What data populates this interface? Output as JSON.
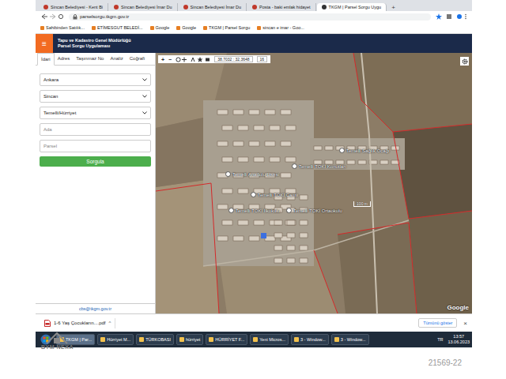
{
  "browser": {
    "tabs": [
      {
        "label": "Sincan Belediyesi - Kent Bi",
        "selected": false
      },
      {
        "label": "Sincan Belediyesi İmar Du",
        "selected": false
      },
      {
        "label": "Sincan Belediyesi İmar Du",
        "selected": false
      },
      {
        "label": "Posta - baki emlak hidayet",
        "selected": false
      },
      {
        "label": "TKGM | Parsel Sorgu Uygu",
        "selected": true
      }
    ],
    "new_tab": "+",
    "address": "parselsorgu.tkgm.gov.tr",
    "bookmarks": [
      "Sahibinden Satılık...",
      "ETİMESGUT BELEDİ...",
      "Google",
      "Google",
      "TKGM | Parsel Sorgu",
      "sincan e imar - Goo..."
    ]
  },
  "app": {
    "menu": "≡",
    "title": "Tapu ve Kadastro Genel Müdürlüğü",
    "subtitle": "Parsel Sorgu Uygulaması"
  },
  "sidebar": {
    "tabs": [
      {
        "label": "İdari",
        "selected": true
      },
      {
        "label": "Adres",
        "selected": false
      },
      {
        "label": "Taşınmaz No",
        "selected": false
      },
      {
        "label": "Analiz",
        "selected": false
      },
      {
        "label": "Coğrafi",
        "selected": false
      }
    ],
    "selects": [
      "Ankara",
      "Sincan",
      "Temelli/Hürriyet"
    ],
    "inputs": [
      {
        "placeholder": "Ada"
      },
      {
        "placeholder": "Parsel"
      }
    ],
    "button": "Sorgula",
    "footer": "cbs@tkgm.gov.tr"
  },
  "map": {
    "toolbar": {
      "buttons": [
        "+",
        "−"
      ],
      "coordinates": "38.7032 : 32.3648",
      "zoom": "16"
    },
    "labels": [
      "Temelli Anadolu Lisesi",
      "Temelli TOKİ Konutları",
      "Temelli Sağlık Ocağı",
      "Temelli TOKİ Camii",
      "Temelli TOKİ İlkokulu",
      "Temelli TOKİ Ortaokulu"
    ],
    "scale": "100 m",
    "attribution": "Google"
  },
  "downloads": {
    "file": "1-6 Yaş Çocukların....pdf",
    "caret": "^",
    "show_all": "Tümünü göster",
    "close": "×"
  },
  "taskbar": {
    "items": [
      {
        "label": "TKGM | Par...",
        "selected": true
      },
      {
        "label": "Hürriyet M...",
        "selected": false
      },
      {
        "label": "TÜRKOBASI",
        "selected": false
      },
      {
        "label": "hürriyet",
        "selected": false
      },
      {
        "label": "HÜRRİYET F...",
        "selected": false
      },
      {
        "label": "Yeni Micros...",
        "selected": false
      },
      {
        "label": "3 - Window...",
        "selected": false
      },
      {
        "label": "3 - Window...",
        "selected": false
      }
    ],
    "language": "TR",
    "time": "13:57",
    "date": "13.06.2023"
  },
  "watermark": {
    "logo": "BYM NEXA",
    "code": "21569-22"
  }
}
